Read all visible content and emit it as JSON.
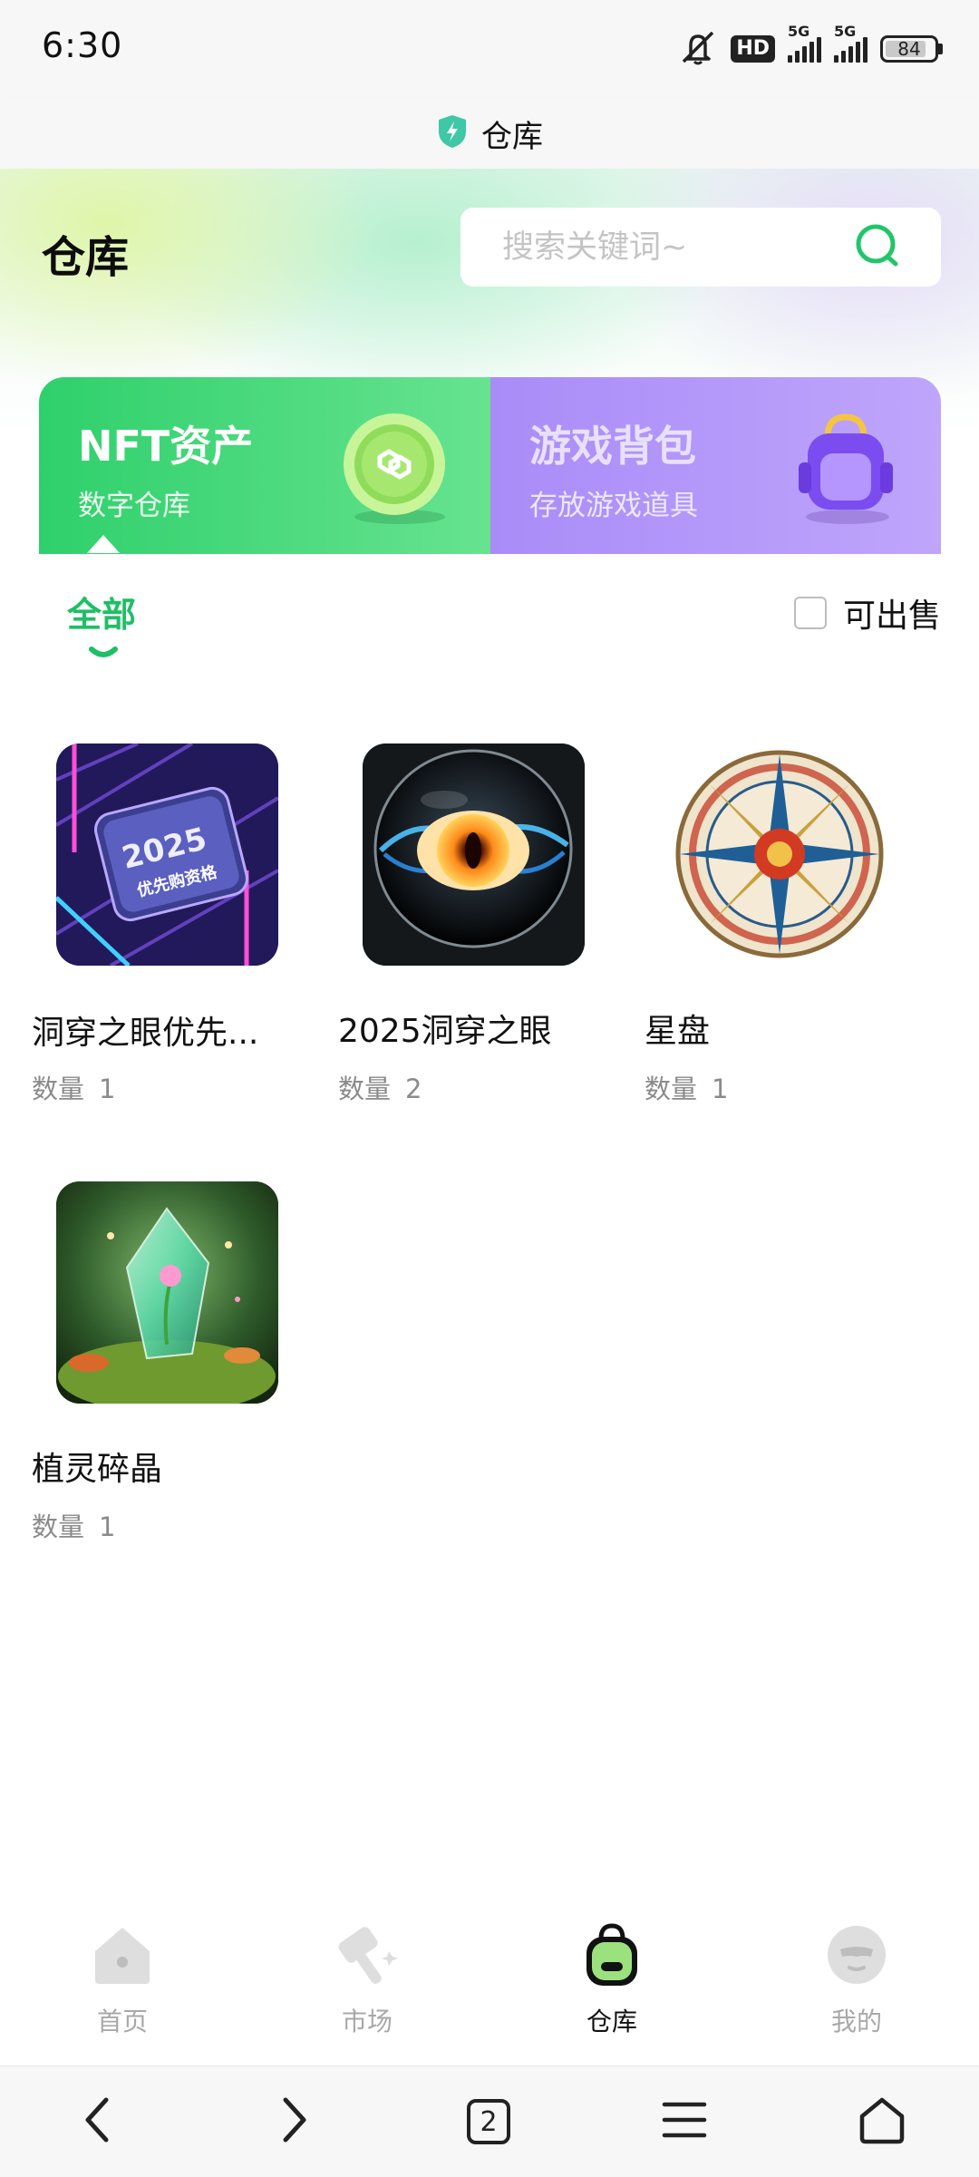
{
  "status_bar": {
    "time": "6:30",
    "hd_label": "HD",
    "signal_1_label": "5G",
    "signal_2_label": "5G",
    "battery": "84",
    "battery_level": 0.84
  },
  "browser": {
    "title": "仓库",
    "tab_count": "2"
  },
  "header": {
    "title": "仓库",
    "search_placeholder": "搜索关键词~"
  },
  "categories": [
    {
      "title": "NFT资产",
      "subtitle": "数字仓库",
      "active": true
    },
    {
      "title": "游戏背包",
      "subtitle": "存放游戏道具",
      "active": false
    }
  ],
  "filters": {
    "tab_all": "全部",
    "sellable_label": "可出售",
    "sellable_checked": false
  },
  "items": [
    {
      "name": "洞穿之眼优先...",
      "qty_label": "数量",
      "qty": "1",
      "image": "2025-priority-badge-image"
    },
    {
      "name": "2025洞穿之眼",
      "qty_label": "数量",
      "qty": "2",
      "image": "eye-orb-image"
    },
    {
      "name": "星盘",
      "qty_label": "数量",
      "qty": "1",
      "image": "compass-rose-image"
    },
    {
      "name": "植灵碎晶",
      "qty_label": "数量",
      "qty": "1",
      "image": "crystal-shard-image"
    }
  ],
  "thumb_text": {
    "year": "2025",
    "caption": "优先购资格"
  },
  "bottom_nav": [
    {
      "label": "首页",
      "icon": "home-icon",
      "active": false
    },
    {
      "label": "市场",
      "icon": "hammer-icon",
      "active": false
    },
    {
      "label": "仓库",
      "icon": "backpack-icon",
      "active": true
    },
    {
      "label": "我的",
      "icon": "profile-icon",
      "active": false
    }
  ],
  "colors": {
    "accent_green": "#1fbf65",
    "nft_card": "#2fd06c",
    "game_card": "#a98cf8"
  }
}
